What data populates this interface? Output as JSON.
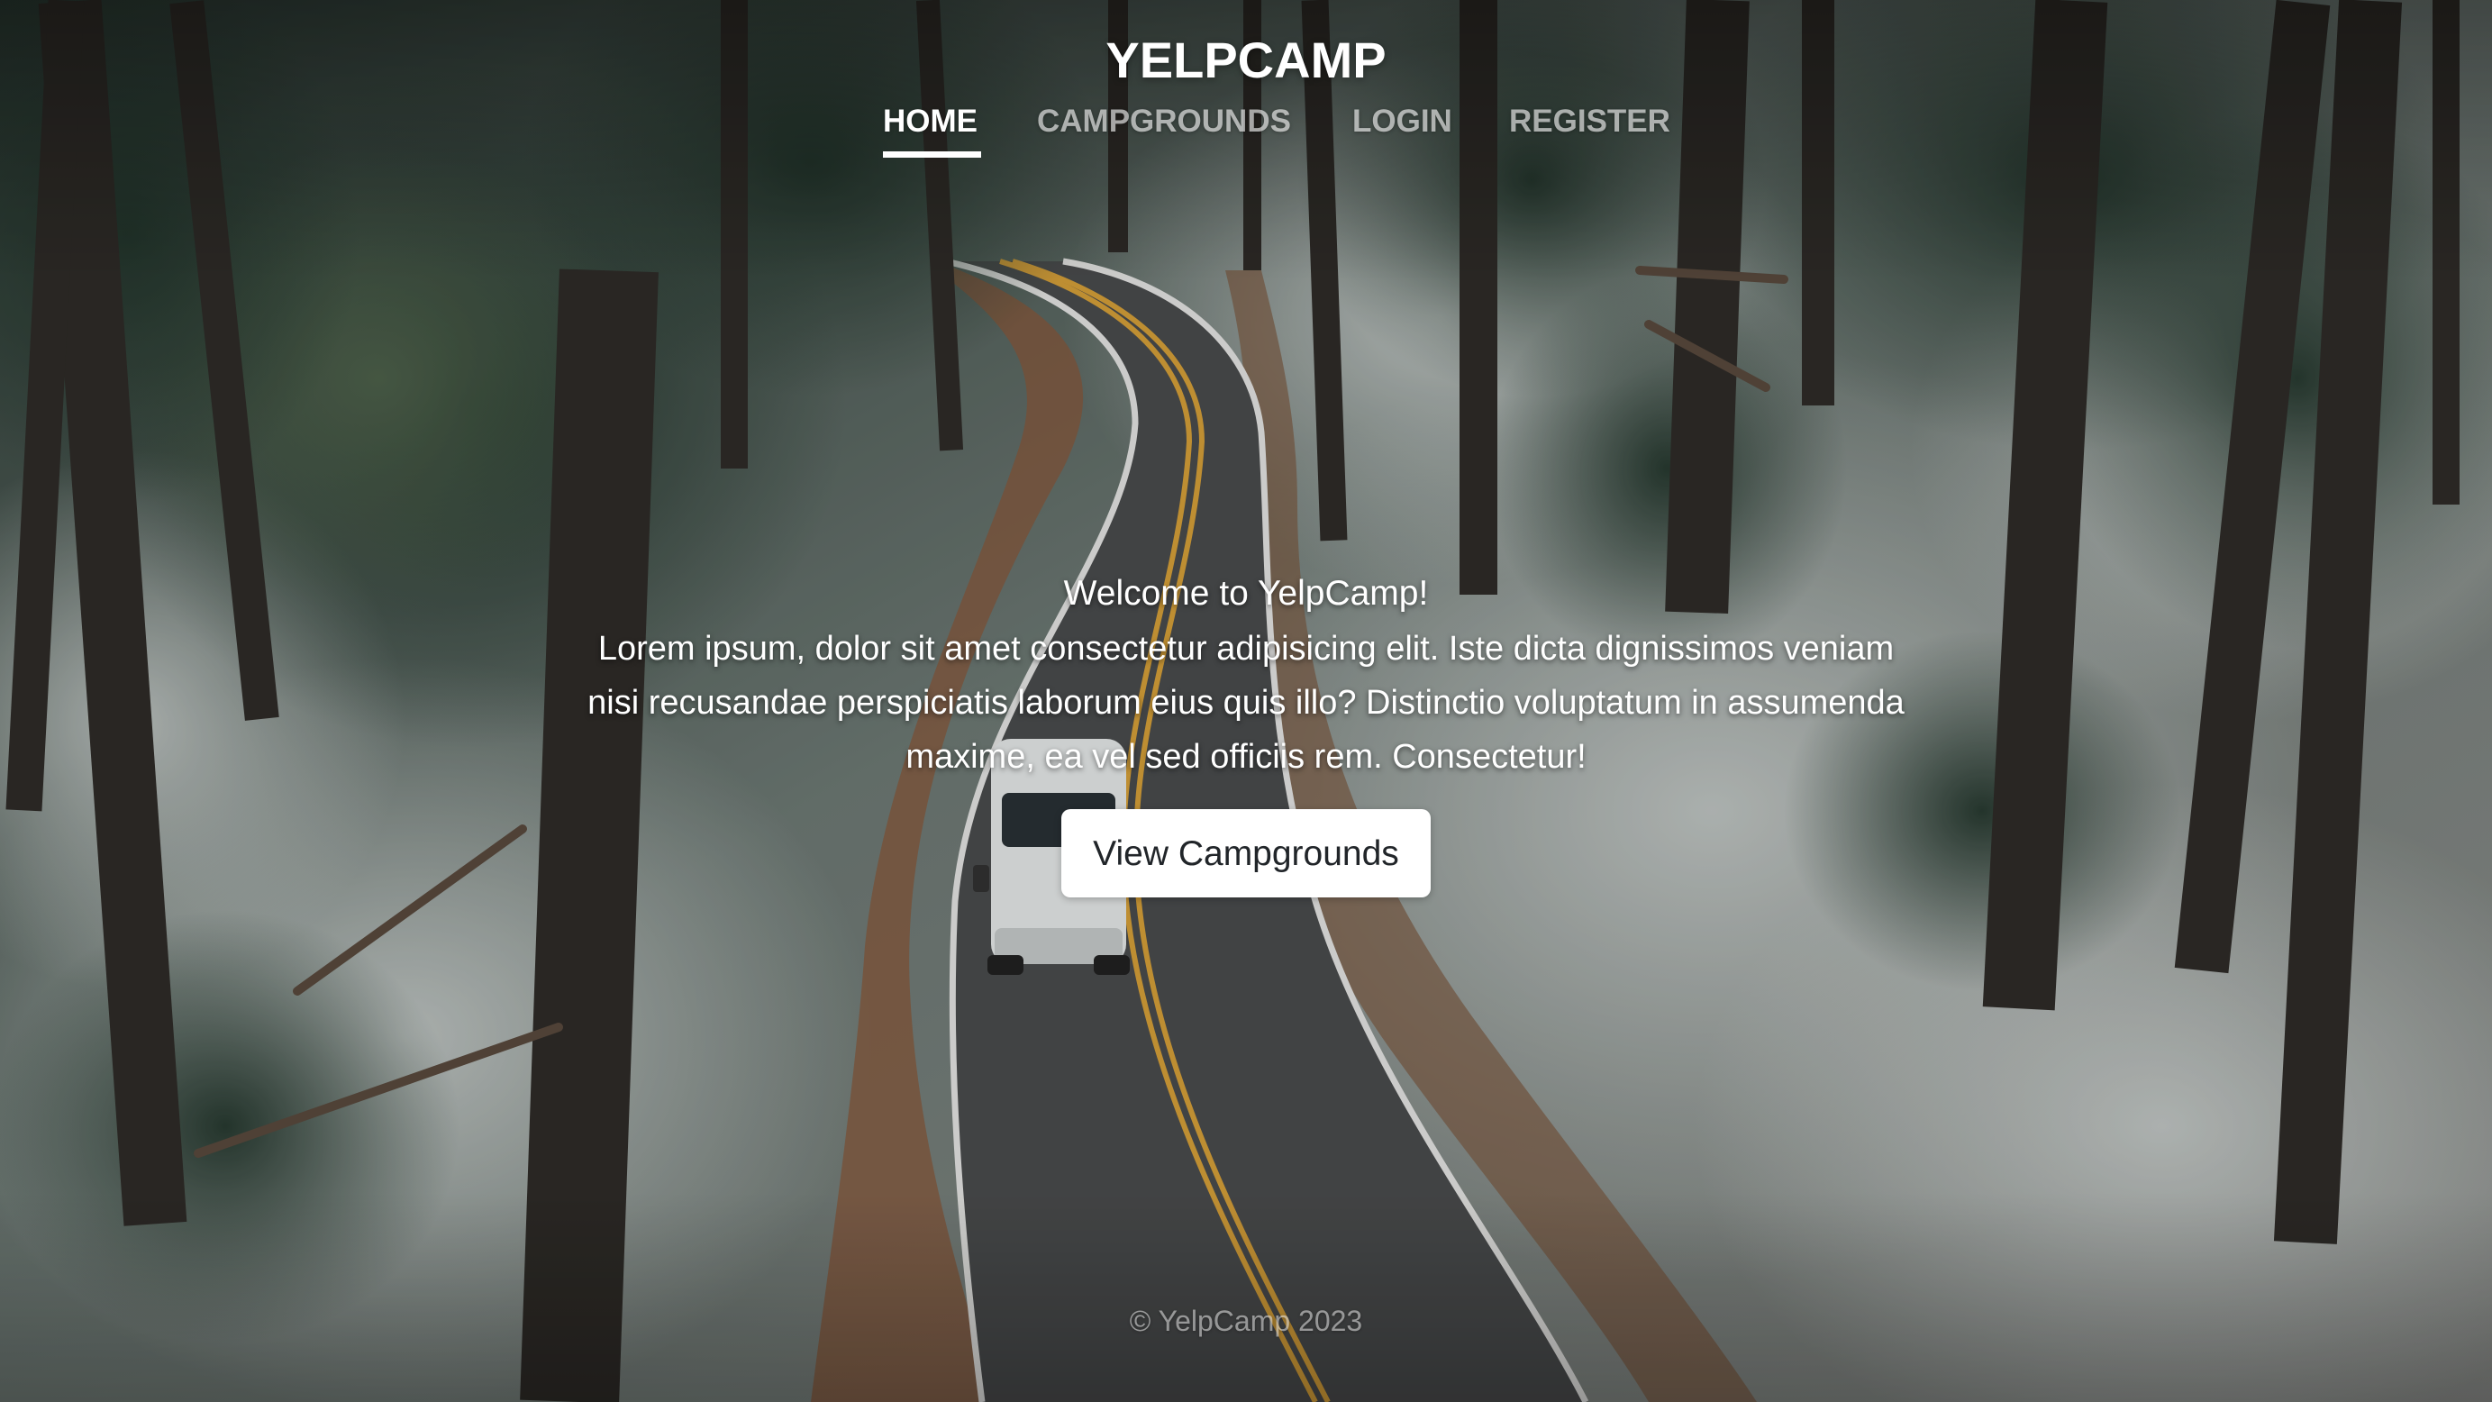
{
  "header": {
    "brand": "YELPCAMP",
    "nav": [
      {
        "label": "HOME",
        "active": true
      },
      {
        "label": "CAMPGROUNDS",
        "active": false
      },
      {
        "label": "LOGIN",
        "active": false
      },
      {
        "label": "REGISTER",
        "active": false
      }
    ]
  },
  "hero": {
    "title": "Welcome to YelpCamp!",
    "lines": [
      "Lorem ipsum, dolor sit amet consectetur adipisicing elit. Iste dicta dignissimos veniam",
      "nisi recusandae perspiciatis laborum eius quis illo? Distinctio voluptatum in assumenda",
      "maxime, ea vel sed officiis rem. Consectetur!"
    ],
    "cta_label": "View Campgrounds"
  },
  "footer": {
    "text": "© YelpCamp 2023"
  },
  "background": {
    "subject": "aerial view of a winding road through a snowy forest with a white van"
  },
  "colors": {
    "text": "#ffffff",
    "nav_inactive": "rgba(255,255,255,0.62)",
    "button_bg": "#ffffff",
    "button_text": "#212529",
    "road_line": "#e0a93a"
  }
}
